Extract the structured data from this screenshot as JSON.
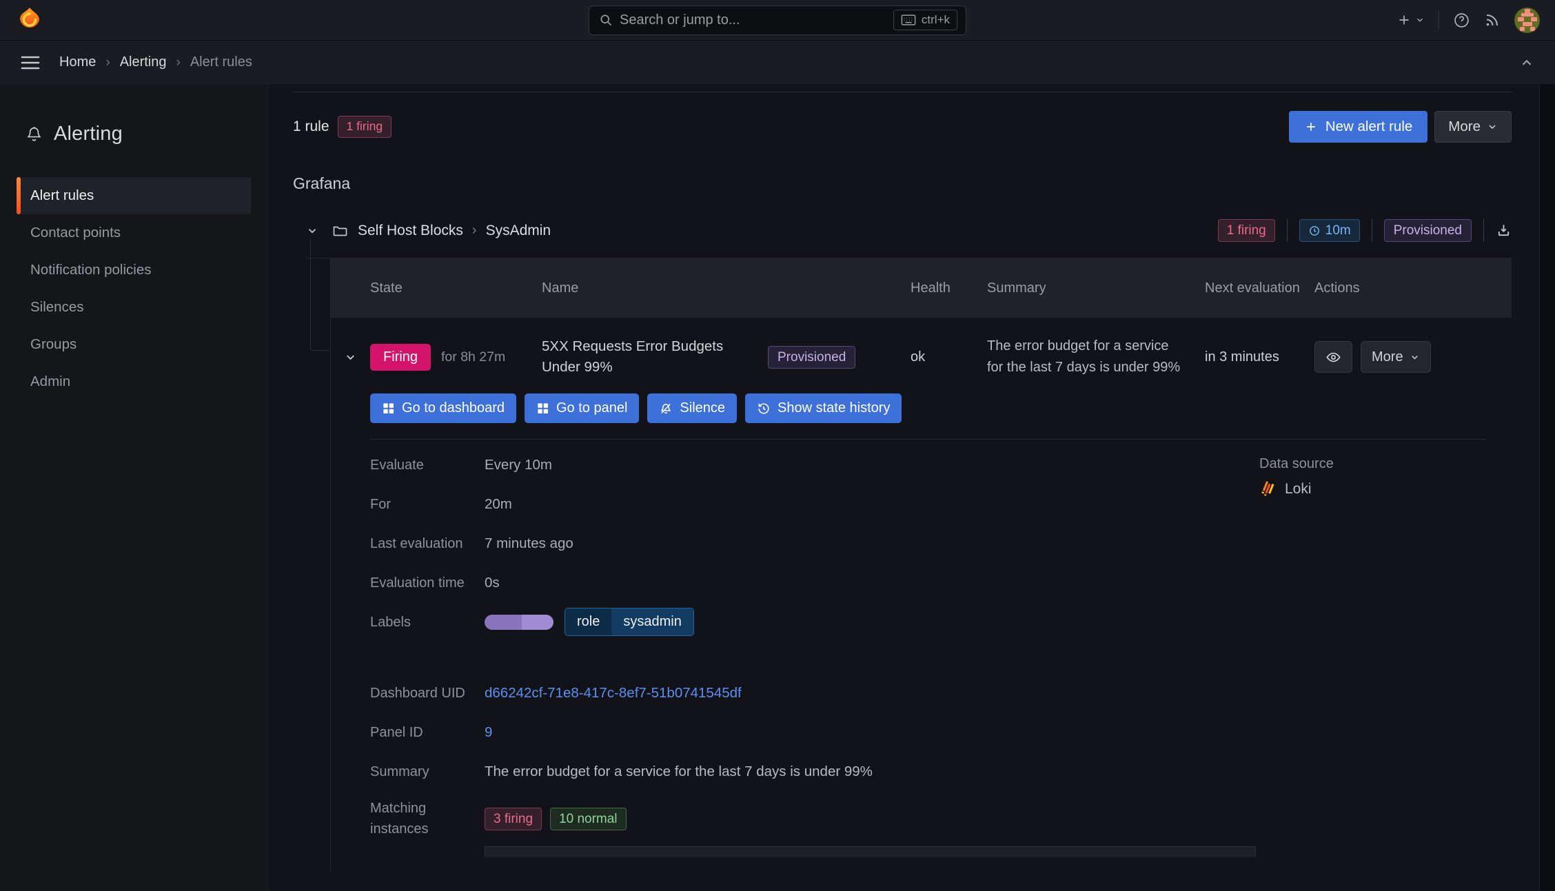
{
  "topnav": {
    "search_placeholder": "Search or jump to...",
    "shortcut": "ctrl+k"
  },
  "breadcrumb": {
    "items": [
      {
        "label": "Home"
      },
      {
        "label": "Alerting"
      },
      {
        "label": "Alert rules"
      }
    ]
  },
  "sidebar": {
    "title": "Alerting",
    "items": [
      {
        "label": "Alert rules"
      },
      {
        "label": "Contact points"
      },
      {
        "label": "Notification policies"
      },
      {
        "label": "Silences"
      },
      {
        "label": "Groups"
      },
      {
        "label": "Admin"
      }
    ]
  },
  "page": {
    "rule_count": "1 rule",
    "firing_badge": "1 firing",
    "new_alert_rule": "New alert rule",
    "more": "More",
    "section_title": "Grafana",
    "group": {
      "folder": "Self Host Blocks",
      "name": "SysAdmin",
      "firing_badge": "1 firing",
      "interval": "10m",
      "provisioned": "Provisioned"
    },
    "table": {
      "headers": [
        "State",
        "Name",
        "Health",
        "Summary",
        "Next evaluation",
        "Actions"
      ]
    },
    "rule": {
      "state": "Firing",
      "duration": "for 8h 27m",
      "name": "5XX Requests Error Budgets Under 99%",
      "provisioned": "Provisioned",
      "health": "ok",
      "summary": "The error budget for a service for the last 7 days is under 99%",
      "next_evaluation": "in 3 minutes",
      "more": "More"
    },
    "rule_actions": [
      {
        "label": "Go to dashboard"
      },
      {
        "label": "Go to panel"
      },
      {
        "label": "Silence"
      },
      {
        "label": "Show state history"
      }
    ],
    "details": {
      "evaluate_label": "Evaluate",
      "evaluate": "Every 10m",
      "for_label": "For",
      "for": "20m",
      "last_evaluation_label": "Last evaluation",
      "last_evaluation": "7 minutes ago",
      "evaluation_time_label": "Evaluation time",
      "evaluation_time": "0s",
      "labels_label": "Labels",
      "label_key": "role",
      "label_value": "sysadmin",
      "datasource_label": "Data source",
      "datasource": "Loki",
      "dashboard_uid_label": "Dashboard UID",
      "dashboard_uid": "d66242cf-71e8-417c-8ef7-51b0741545df",
      "panel_id_label": "Panel ID",
      "panel_id": "9",
      "summary_label": "Summary",
      "summary": "The error budget for a service for the last 7 days is under 99%",
      "matching_label": "Matching instances",
      "matching_firing": "3 firing",
      "matching_normal": "10 normal"
    }
  },
  "colors": {
    "accent_blue": "#3D71D9",
    "firing_pink": "#D4136A",
    "brand_orange": "#F4501E",
    "link_blue": "#5D8EF2",
    "success_green": "#8FD19B",
    "provisioned_purple": "#C6B2E6"
  }
}
